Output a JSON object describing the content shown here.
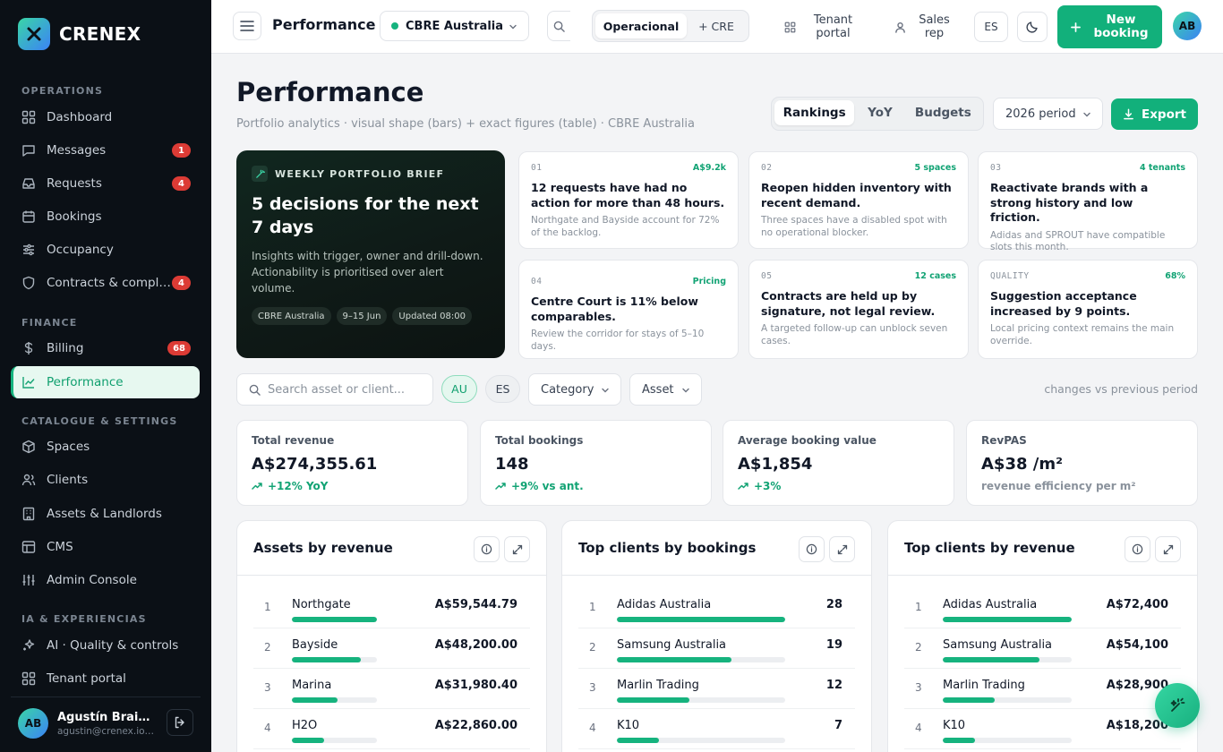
{
  "sidebar": {
    "brand": "CRENEX",
    "sections": {
      "operations": "OPERATIONS",
      "finance": "FINANCE",
      "catalogue": "CATALOGUE & SETTINGS",
      "ia": "IA & EXPERIENCIAS"
    },
    "items": {
      "dashboard": {
        "label": "Dashboard"
      },
      "messages": {
        "label": "Messages",
        "badge": "1"
      },
      "requests": {
        "label": "Requests",
        "badge": "4"
      },
      "bookings": {
        "label": "Bookings"
      },
      "occupancy": {
        "label": "Occupancy"
      },
      "contracts": {
        "label": "Contracts & compl…",
        "badge": "4"
      },
      "billing": {
        "label": "Billing",
        "badge": "68"
      },
      "performance": {
        "label": "Performance"
      },
      "spaces": {
        "label": "Spaces"
      },
      "clients": {
        "label": "Clients"
      },
      "assets": {
        "label": "Assets & Landlords"
      },
      "cms": {
        "label": "CMS"
      },
      "admin": {
        "label": "Admin Console"
      },
      "ai": {
        "label": "AI · Quality & controls"
      },
      "tenant": {
        "label": "Tenant portal"
      }
    },
    "user": {
      "initials": "AB",
      "name": "Agustín Braid…",
      "email": "agustin@crenex.io…"
    }
  },
  "topbar": {
    "title": "Performance",
    "org": "CBRE Australia",
    "mode_tabs": [
      "Operacional",
      "+ CRE"
    ],
    "tenant_portal": "Tenant portal",
    "sales_rep": "Sales rep",
    "lang": "ES",
    "new_booking": "New booking",
    "avatar": "AB"
  },
  "page": {
    "title": "Performance",
    "subtitle": "Portfolio analytics · visual shape (bars) + exact figures (table) · CBRE Australia",
    "view_tabs": [
      "Rankings",
      "YoY",
      "Budgets"
    ],
    "period": "2026 period",
    "export": "Export"
  },
  "brief": {
    "tag": "WEEKLY PORTFOLIO BRIEF",
    "title": "5 decisions for the next 7 days",
    "description": "Insights with trigger, owner and drill-down. Actionability is prioritised over alert volume.",
    "chips": [
      "CBRE Australia",
      "9–15 Jun",
      "Updated 08:00"
    ]
  },
  "insights": [
    {
      "num": "01",
      "value": "A$9.2k",
      "title": "12 requests have had no action for more than 48 hours.",
      "desc": "Northgate and Bayside account for 72% of the backlog."
    },
    {
      "num": "02",
      "value": "5 spaces",
      "title": "Reopen hidden inventory with recent demand.",
      "desc": "Three spaces have a disabled spot with no operational blocker."
    },
    {
      "num": "03",
      "value": "4 tenants",
      "title": "Reactivate brands with a strong history and low friction.",
      "desc": "Adidas and SPROUT have compatible slots this month."
    },
    {
      "num": "04",
      "value": "Pricing",
      "title": "Centre Court is 11% below comparables.",
      "desc": "Review the corridor for stays of 5–10 days."
    },
    {
      "num": "05",
      "value": "12 cases",
      "title": "Contracts are held up by signature, not legal review.",
      "desc": "A targeted follow-up can unblock seven cases."
    },
    {
      "num": "QUALITY",
      "value": "68%",
      "title": "Suggestion acceptance increased by 9 points.",
      "desc": "Local pricing context remains the main override."
    }
  ],
  "filters": {
    "search_placeholder": "Search asset or client...",
    "region_au": "AU",
    "region_es": "ES",
    "category": "Category",
    "asset": "Asset",
    "note": "changes vs previous period"
  },
  "kpis": [
    {
      "label": "Total revenue",
      "value": "A$274,355.61",
      "delta": "+12% YoY"
    },
    {
      "label": "Total bookings",
      "value": "148",
      "delta": "+9% vs ant."
    },
    {
      "label": "Average booking value",
      "value": "A$1,854",
      "delta": "+3%"
    },
    {
      "label": "RevPAS",
      "value": "A$38 /m²",
      "delta": "revenue efficiency per m²"
    }
  ],
  "rankings": [
    {
      "title": "Assets by revenue",
      "rows": [
        {
          "rank": "1",
          "name": "Northgate",
          "value": "A$59,544.79",
          "share": 1.0
        },
        {
          "rank": "2",
          "name": "Bayside",
          "value": "A$48,200.00",
          "share": 0.81
        },
        {
          "rank": "3",
          "name": "Marina",
          "value": "A$31,980.40",
          "share": 0.54
        },
        {
          "rank": "4",
          "name": "H2O",
          "value": "A$22,860.00",
          "share": 0.38
        }
      ]
    },
    {
      "title": "Top clients by bookings",
      "rows": [
        {
          "rank": "1",
          "name": "Adidas Australia",
          "value": "28",
          "share": 1.0
        },
        {
          "rank": "2",
          "name": "Samsung Australia",
          "value": "19",
          "share": 0.68
        },
        {
          "rank": "3",
          "name": "Marlin Trading",
          "value": "12",
          "share": 0.43
        },
        {
          "rank": "4",
          "name": "K10",
          "value": "7",
          "share": 0.25
        }
      ]
    },
    {
      "title": "Top clients by revenue",
      "rows": [
        {
          "rank": "1",
          "name": "Adidas Australia",
          "value": "A$72,400",
          "share": 1.0
        },
        {
          "rank": "2",
          "name": "Samsung Australia",
          "value": "A$54,100",
          "share": 0.75
        },
        {
          "rank": "3",
          "name": "Marlin Trading",
          "value": "A$28,900",
          "share": 0.4
        },
        {
          "rank": "4",
          "name": "K10",
          "value": "A$18,200",
          "share": 0.25
        }
      ]
    }
  ],
  "colors": {
    "accent": "#12b07b",
    "sidebar": "#0b1016",
    "badge": "#dc3b35",
    "positive": "#12a374"
  }
}
